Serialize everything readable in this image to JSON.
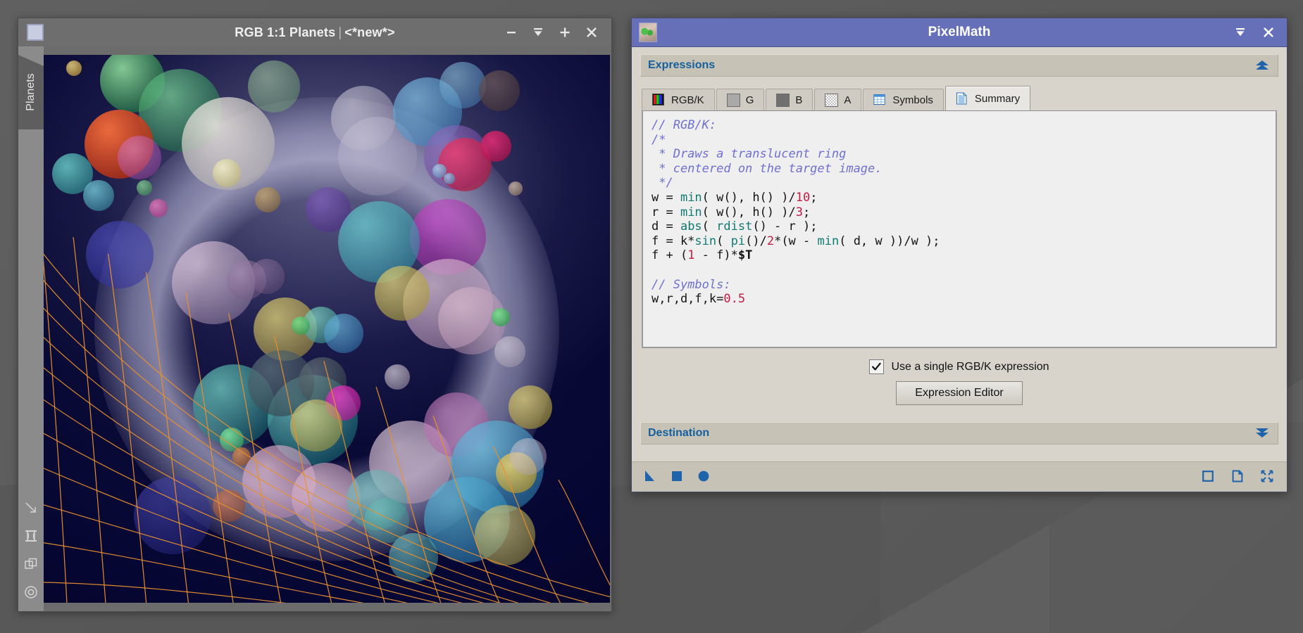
{
  "image_window": {
    "title_main": "RGB 1:1 Planets",
    "title_sep": "|",
    "title_doc": "<*new*>",
    "side_tab_label": "Planets",
    "buttons": [
      {
        "name": "minimize",
        "glyph": "minimize-icon"
      },
      {
        "name": "rollup",
        "glyph": "rollup-icon"
      },
      {
        "name": "maximize",
        "glyph": "plus-icon"
      },
      {
        "name": "close",
        "glyph": "close-icon"
      }
    ],
    "tools": [
      {
        "name": "arrow-diagonal-icon"
      },
      {
        "name": "transform-frame-icon"
      },
      {
        "name": "duplicate-layers-icon"
      },
      {
        "name": "target-circle-icon"
      }
    ]
  },
  "pixelmath": {
    "title": "PixelMath",
    "title_buttons": [
      {
        "name": "rollup",
        "glyph": "rollup-icon"
      },
      {
        "name": "close",
        "glyph": "close-icon"
      }
    ],
    "expressions_section": {
      "title": "Expressions",
      "collapse_icon": "double-chevron-up-icon"
    },
    "tabs": [
      {
        "label": "RGB/K",
        "icon": "rgb-stripes-icon",
        "active": false
      },
      {
        "label": "G",
        "icon": "gray-light-swatch-icon",
        "active": false
      },
      {
        "label": "B",
        "icon": "gray-dark-swatch-icon",
        "active": false
      },
      {
        "label": "A",
        "icon": "checkerboard-swatch-icon",
        "active": false
      },
      {
        "label": "Symbols",
        "icon": "table-grid-icon",
        "active": false
      },
      {
        "label": "Summary",
        "icon": "document-lines-icon",
        "active": true
      }
    ],
    "code": {
      "lines": [
        [
          {
            "t": "// RGB/K:",
            "c": "cm"
          }
        ],
        [
          {
            "t": "/*",
            "c": "cm"
          }
        ],
        [
          {
            "t": " * Draws a translucent ring",
            "c": "cm"
          }
        ],
        [
          {
            "t": " * centered on the target image.",
            "c": "cm"
          }
        ],
        [
          {
            "t": " */",
            "c": "cm"
          }
        ],
        [
          {
            "t": "w = ",
            "c": ""
          },
          {
            "t": "min",
            "c": "fn"
          },
          {
            "t": "( w(), h() )/",
            "c": ""
          },
          {
            "t": "10",
            "c": "num"
          },
          {
            "t": ";",
            "c": ""
          }
        ],
        [
          {
            "t": "r = ",
            "c": ""
          },
          {
            "t": "min",
            "c": "fn"
          },
          {
            "t": "( w(), h() )/",
            "c": ""
          },
          {
            "t": "3",
            "c": "num"
          },
          {
            "t": ";",
            "c": ""
          }
        ],
        [
          {
            "t": "d = ",
            "c": ""
          },
          {
            "t": "abs",
            "c": "fn"
          },
          {
            "t": "( ",
            "c": ""
          },
          {
            "t": "rdist",
            "c": "fn"
          },
          {
            "t": "() - r );",
            "c": ""
          }
        ],
        [
          {
            "t": "f = k*",
            "c": ""
          },
          {
            "t": "sin",
            "c": "fn"
          },
          {
            "t": "( ",
            "c": ""
          },
          {
            "t": "pi",
            "c": "fn"
          },
          {
            "t": "()/",
            "c": ""
          },
          {
            "t": "2",
            "c": "num"
          },
          {
            "t": "*(w - ",
            "c": ""
          },
          {
            "t": "min",
            "c": "fn"
          },
          {
            "t": "( d, w ))/w );",
            "c": ""
          }
        ],
        [
          {
            "t": "f + (",
            "c": ""
          },
          {
            "t": "1",
            "c": "num"
          },
          {
            "t": " - f)*",
            "c": ""
          },
          {
            "t": "$T",
            "c": "tgt"
          }
        ],
        [
          {
            "t": "",
            "c": ""
          }
        ],
        [
          {
            "t": "// Symbols:",
            "c": "cm"
          }
        ],
        [
          {
            "t": "w,r,d,f,k=",
            "c": ""
          },
          {
            "t": "0.5",
            "c": "num"
          }
        ]
      ]
    },
    "single_expression": {
      "label": "Use a single RGB/K expression",
      "checked": true,
      "check_glyph": "checkmark-icon"
    },
    "expression_editor_button": "Expression Editor",
    "destination_section": {
      "title": "Destination",
      "expand_icon": "double-chevron-down-icon"
    },
    "toolbar": {
      "left_icons": [
        {
          "name": "apply-triangle-icon"
        },
        {
          "name": "apply-global-square-icon"
        },
        {
          "name": "execute-circle-icon"
        }
      ],
      "right_icons": [
        {
          "name": "new-instance-square-icon"
        },
        {
          "name": "browse-documentation-icon"
        },
        {
          "name": "reset-collapse-icon"
        }
      ]
    }
  },
  "colors": {
    "pm_titlebar": "#6670b8",
    "section_title": "#15609e",
    "toolbar_icon": "#1f64ab",
    "code_comment": "#6f6fd0",
    "code_function": "#107a72",
    "code_number": "#c41a45",
    "grid_overlay": "#e8902f",
    "window_titlebar": "#6e6e6e",
    "desktop": "#5a5a5a"
  }
}
